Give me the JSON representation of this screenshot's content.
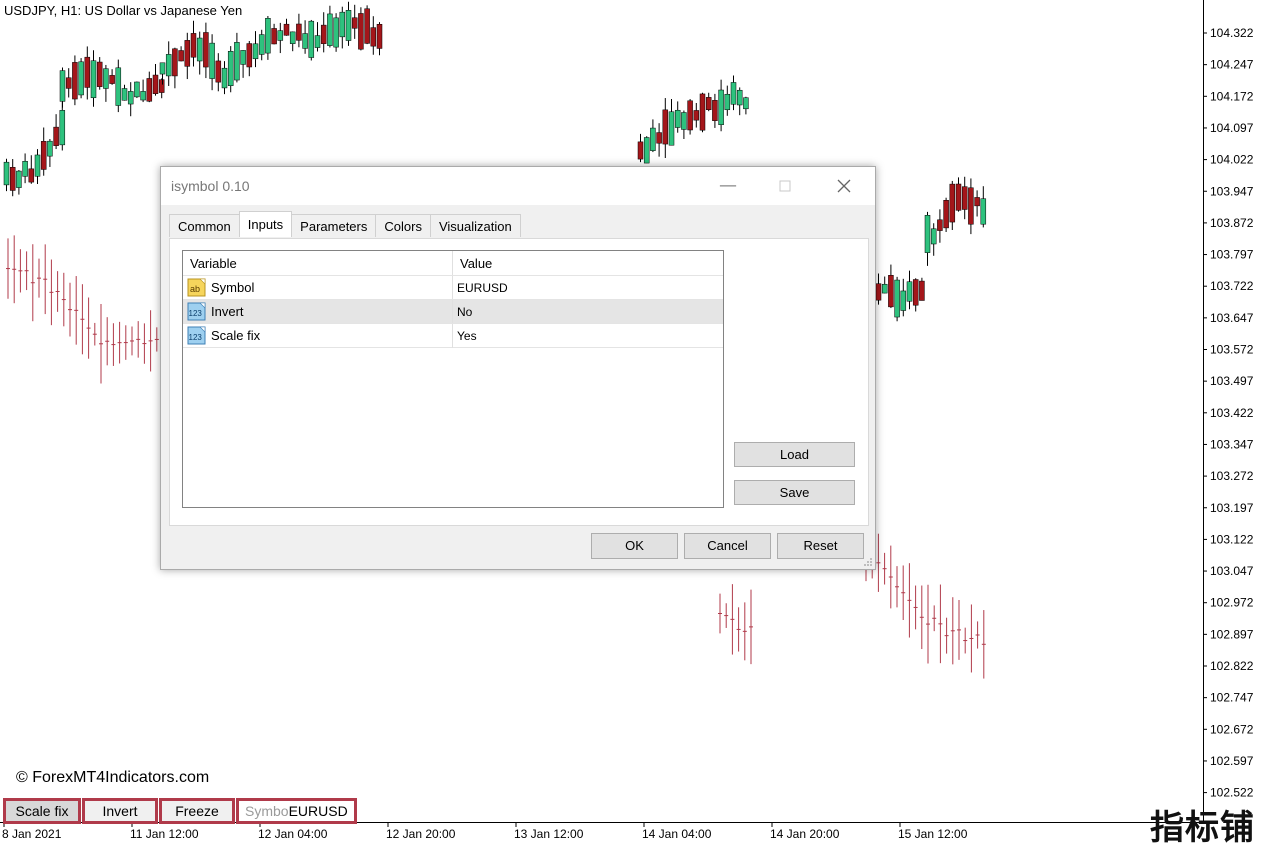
{
  "chart": {
    "title": "USDJPY, H1:  US Dollar vs Japanese Yen",
    "copyright": "© ForexMT4Indicators.com",
    "watermark": "指标铺",
    "price_labels": [
      "104.322",
      "104.247",
      "104.172",
      "104.097",
      "104.022",
      "103.947",
      "103.872",
      "103.797",
      "103.722",
      "103.647",
      "103.572",
      "103.497",
      "103.422",
      "103.347",
      "103.272",
      "103.197",
      "103.122",
      "103.047",
      "102.972",
      "102.897",
      "102.822",
      "102.747",
      "102.672",
      "102.597",
      "102.522"
    ],
    "time_labels": [
      "8 Jan 2021",
      "11 Jan 12:00",
      "12 Jan 04:00",
      "12 Jan 20:00",
      "13 Jan 12:00",
      "14 Jan 04:00",
      "14 Jan 20:00",
      "15 Jan 12:00"
    ],
    "colors": {
      "bull": "#2ec27e",
      "bear": "#a4161a",
      "overlay": "#b03a4a",
      "wick": "#000000"
    }
  },
  "indicator_buttons": {
    "scale_fix": "Scale fix",
    "invert": "Invert",
    "freeze": "Freeze",
    "symbol_placeholder": "Symbo",
    "symbol_value": "EURUSD"
  },
  "dialog": {
    "title": "isymbol 0.10",
    "tabs": [
      "Common",
      "Inputs",
      "Parameters",
      "Colors",
      "Visualization"
    ],
    "active_tab": "Inputs",
    "grid": {
      "headers": {
        "variable": "Variable",
        "value": "Value"
      },
      "rows": [
        {
          "icon": "ab",
          "variable": "Symbol",
          "value": "EURUSD"
        },
        {
          "icon": "123",
          "variable": "Invert",
          "value": "No"
        },
        {
          "icon": "123",
          "variable": "Scale fix",
          "value": "Yes"
        }
      ]
    },
    "load": "Load",
    "save": "Save",
    "ok": "OK",
    "cancel": "Cancel",
    "reset": "Reset"
  }
}
